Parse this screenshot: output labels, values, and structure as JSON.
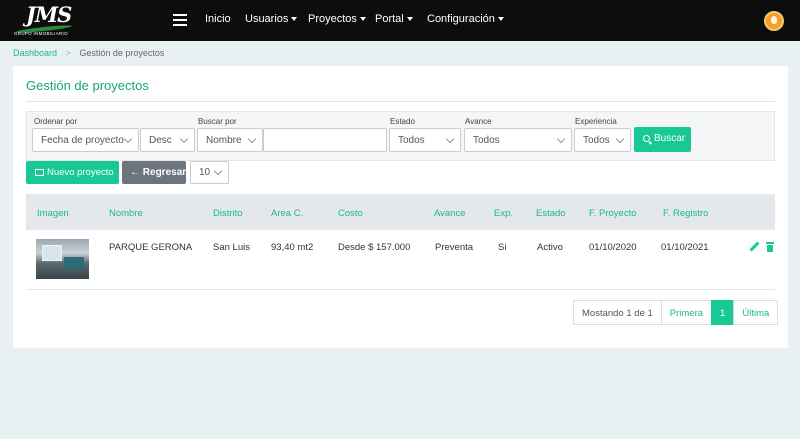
{
  "brand": {
    "logo_text": "JMS",
    "logo_subtitle": "GRUPO INMOBILIARIO"
  },
  "nav": {
    "items": [
      {
        "label": "Inicio",
        "dropdown": false
      },
      {
        "label": "Usuarios",
        "dropdown": true
      },
      {
        "label": "Proyectos",
        "dropdown": true
      },
      {
        "label": "Portal",
        "dropdown": true
      },
      {
        "label": "Configuración",
        "dropdown": true
      }
    ]
  },
  "breadcrumb": {
    "home": "Dashboard",
    "current": "Gestión de proyectos"
  },
  "page": {
    "title": "Gestión de proyectos"
  },
  "filters": {
    "order_label": "Ordenar por",
    "order_value": "Fecha de proyecto",
    "direction_value": "Desc",
    "search_label": "Buscar por",
    "search_field_value": "Nombre",
    "search_text": "",
    "status_label": "Estado",
    "status_value": "Todos",
    "progress_label": "Avance",
    "progress_value": "Todos",
    "experience_label": "Experiencia",
    "experience_value": "Todos",
    "search_button": "Buscar"
  },
  "actions": {
    "new_label": "Nuevo proyecto",
    "back_label": "Regresar",
    "page_size": "10"
  },
  "table": {
    "headers": [
      "Imagen",
      "Nombre",
      "Distrito",
      "Area C.",
      "Costo",
      "Avance",
      "Exp.",
      "Estado",
      "F. Proyecto",
      "F. Registro"
    ],
    "rows": [
      {
        "name": "PARQUE GERONA",
        "district": "San Luis",
        "area": "93,40 mt2",
        "cost": "Desde $ 157.000",
        "progress": "Preventa",
        "exp": "Si",
        "status": "Activo",
        "project_date": "01/10/2020",
        "register_date": "01/10/2021"
      }
    ]
  },
  "pagination": {
    "info": "Mostando 1 de 1",
    "first": "Primera",
    "current": "1",
    "last": "Última"
  },
  "colors": {
    "accent": "#19c995",
    "navbar": "#0d0d0d",
    "secondary": "#6c757d"
  }
}
